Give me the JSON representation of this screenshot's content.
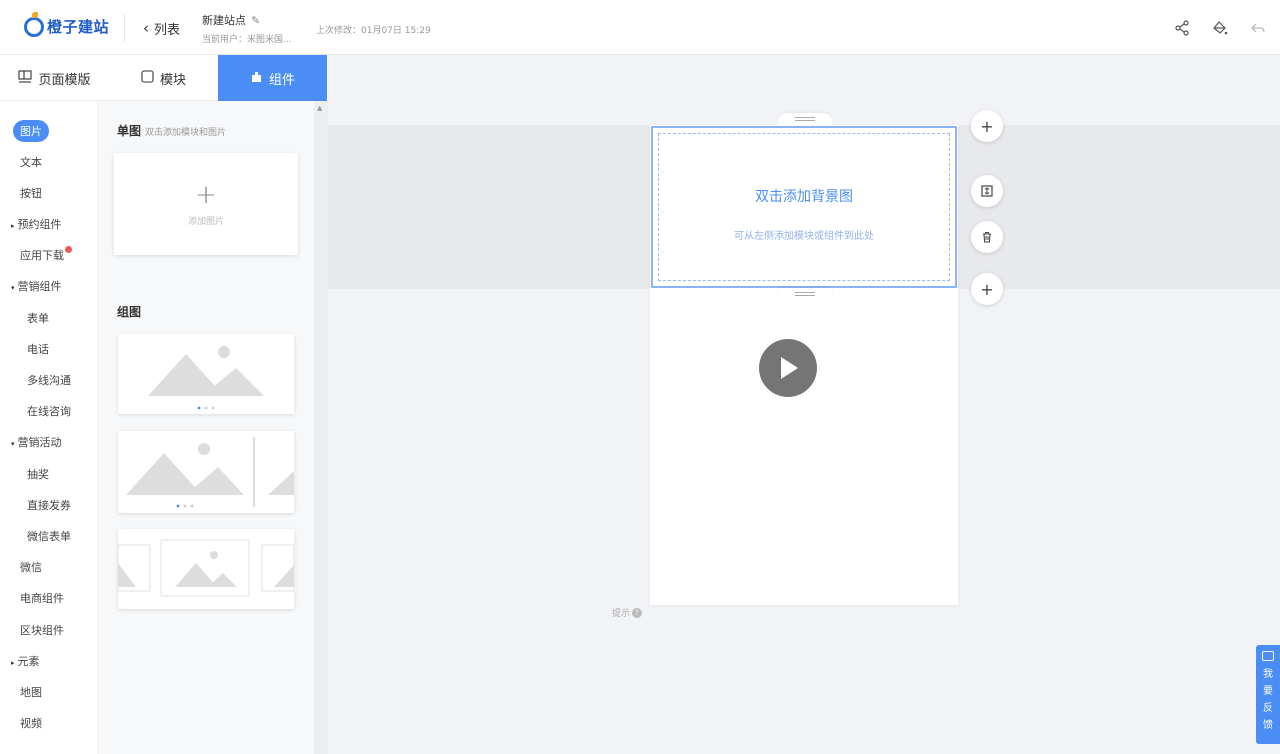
{
  "header": {
    "logo_text": "橙子建站",
    "back_label": "列表",
    "site_name": "新建站点",
    "current_user": "当前用户：米图米国...",
    "last_modified": "上次修改：01月07日 15:29"
  },
  "tabs": [
    {
      "label": "页面模版",
      "icon": "template-icon"
    },
    {
      "label": "模块",
      "icon": "module-icon"
    },
    {
      "label": "组件",
      "icon": "component-icon"
    }
  ],
  "categories": [
    {
      "label": "图片"
    },
    {
      "label": "文本"
    },
    {
      "label": "按钮"
    },
    {
      "label": "预约组件"
    },
    {
      "label": "应用下载"
    },
    {
      "label": "营销组件"
    },
    {
      "label": "表单"
    },
    {
      "label": "电话"
    },
    {
      "label": "多线沟通"
    },
    {
      "label": "在线咨询"
    },
    {
      "label": "营销活动"
    },
    {
      "label": "抽奖"
    },
    {
      "label": "直接发券"
    },
    {
      "label": "微信表单"
    },
    {
      "label": "微信"
    },
    {
      "label": "电商组件"
    },
    {
      "label": "区块组件"
    },
    {
      "label": "元素"
    },
    {
      "label": "地图"
    },
    {
      "label": "视频"
    }
  ],
  "panel": {
    "single_title": "单图",
    "single_hint": "双击添加模块和图片",
    "add_image_label": "添加图片",
    "group_title": "组图"
  },
  "canvas": {
    "bg_title": "双击添加背景图",
    "bg_subtitle": "可从左侧添加模块或组件到此处",
    "help_text": "提示"
  },
  "feedback": {
    "chars": [
      "我",
      "要",
      "反",
      "馈"
    ]
  },
  "colors": {
    "accent": "#4a8ef5",
    "brand": "#1f5cc7",
    "badge": "#f25555"
  }
}
